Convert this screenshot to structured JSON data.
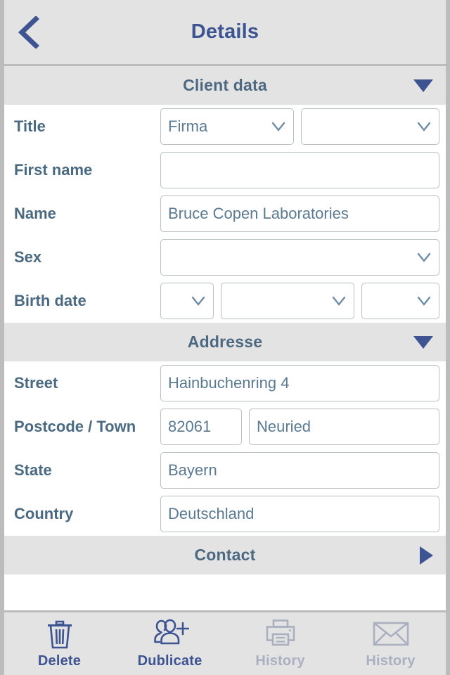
{
  "header": {
    "title": "Details",
    "back_icon": "chevron-left-icon"
  },
  "colors": {
    "accent": "#3d5392",
    "label": "#4a6a82",
    "value": "#5a7a92",
    "section_bg": "#e3e3e3",
    "disabled": "#aab0c0",
    "border": "#b9bfc4"
  },
  "sections": [
    {
      "id": "client-data",
      "title": "Client data",
      "expanded": true,
      "marker_icon": "triangle-down-icon"
    },
    {
      "id": "addresse",
      "title": "Addresse",
      "expanded": true,
      "marker_icon": "triangle-down-icon"
    },
    {
      "id": "contact",
      "title": "Contact",
      "expanded": false,
      "marker_icon": "triangle-right-icon"
    }
  ],
  "client_data": {
    "title": {
      "label": "Title",
      "select_primary": "Firma",
      "select_secondary": ""
    },
    "first_name": {
      "label": "First name",
      "value": ""
    },
    "name": {
      "label": "Name",
      "value": "Bruce Copen Laboratories"
    },
    "sex": {
      "label": "Sex",
      "value": ""
    },
    "birth_date": {
      "label": "Birth date",
      "day": "",
      "month": "",
      "year": ""
    }
  },
  "addresse": {
    "street": {
      "label": "Street",
      "value": "Hainbuchenring 4"
    },
    "postcode_town": {
      "label": "Postcode / Town",
      "postcode": "82061",
      "town": "Neuried"
    },
    "state": {
      "label": "State",
      "value": "Bayern"
    },
    "country": {
      "label": "Country",
      "value": "Deutschland"
    }
  },
  "tabbar": {
    "items": [
      {
        "label": "Delete",
        "icon": "trash-icon",
        "enabled": true
      },
      {
        "label": "Dublicate",
        "icon": "user-add-icon",
        "enabled": true
      },
      {
        "label": "History",
        "icon": "printer-icon",
        "enabled": false
      },
      {
        "label": "History",
        "icon": "envelope-icon",
        "enabled": false
      }
    ]
  }
}
